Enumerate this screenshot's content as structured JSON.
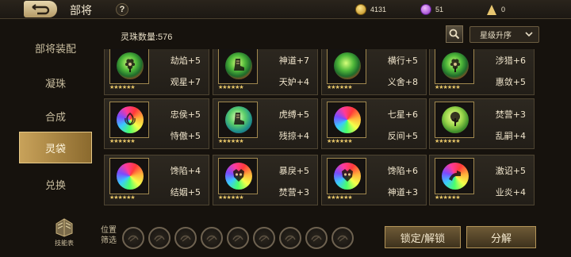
{
  "header": {
    "title": "部将",
    "help_label": "?",
    "gold": "4131",
    "gems": "51",
    "stamina": "0"
  },
  "sidebar": {
    "items": [
      {
        "label": "部将装配",
        "active": false
      },
      {
        "label": "凝珠",
        "active": false
      },
      {
        "label": "合成",
        "active": false
      },
      {
        "label": "灵袋",
        "active": true
      },
      {
        "label": "兑换",
        "active": false
      }
    ],
    "skills_label": "技能表"
  },
  "main": {
    "count_label": "灵珠数量:576",
    "sort_label": "星级升序"
  },
  "cards": [
    {
      "attr1": "劫焰+5",
      "attr2": "观星+7",
      "orb": "green-red",
      "icon": "flower-icon"
    },
    {
      "attr1": "神道+7",
      "attr2": "天妒+4",
      "orb": "green-red",
      "icon": "boot-icon"
    },
    {
      "attr1": "横行+5",
      "attr2": "义舍+8",
      "orb": "green-red",
      "icon": "none"
    },
    {
      "attr1": "涉猎+6",
      "attr2": "惠敛+5",
      "orb": "green-red",
      "icon": "flower-icon"
    },
    {
      "attr1": "忠侯+5",
      "attr2": "恃傲+5",
      "orb": "rainbow",
      "icon": "lotus-icon"
    },
    {
      "attr1": "虎缚+5",
      "attr2": "残掠+4",
      "orb": "green-blue",
      "icon": "boot-icon"
    },
    {
      "attr1": "七星+6",
      "attr2": "反间+5",
      "orb": "rainbow",
      "icon": "none"
    },
    {
      "attr1": "焚营+3",
      "attr2": "乱嗣+4",
      "orb": "green-yellow",
      "icon": "tree-icon"
    },
    {
      "attr1": "馋陷+4",
      "attr2": "结姻+5",
      "orb": "rainbow",
      "icon": "none"
    },
    {
      "attr1": "暴戾+5",
      "attr2": "焚营+3",
      "orb": "rainbow",
      "icon": "mask-icon"
    },
    {
      "attr1": "馋陷+6",
      "attr2": "神道+3",
      "orb": "rainbow",
      "icon": "mask-icon"
    },
    {
      "attr1": "激诏+5",
      "attr2": "业炎+4",
      "orb": "rainbow",
      "icon": "arm-icon"
    }
  ],
  "card_stars": "★★★★★★",
  "bottom": {
    "filter_label_1": "位置",
    "filter_label_2": "筛选",
    "filter_slots": 9,
    "lock_label": "锁定/解锁",
    "decompose_label": "分解"
  },
  "colors": {
    "accent_gold": "#c8a25a",
    "background": "#16120d",
    "card_bg": "#2d2820",
    "star": "#e9c86a"
  }
}
